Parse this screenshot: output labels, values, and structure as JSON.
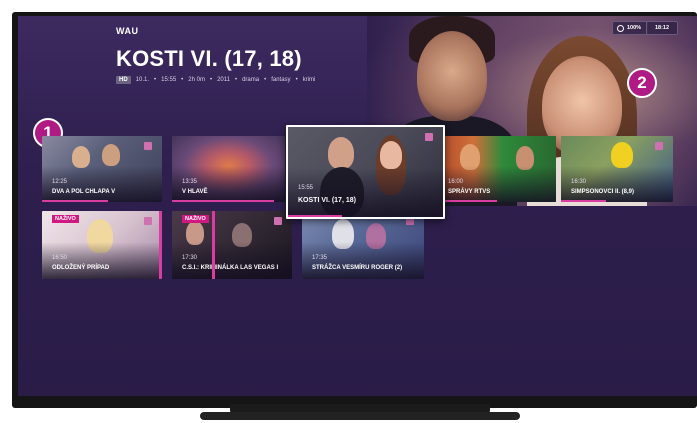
{
  "app": {
    "logo": "WAU",
    "title": "KOSTI VI. (17, 18)"
  },
  "meta": {
    "quality_badge": "HD",
    "items": [
      "10.1.",
      "•",
      "15:55",
      "•",
      "2h 0m",
      "•",
      "2011",
      "•",
      "drama",
      "•",
      "fantasy",
      "•",
      "krimi"
    ]
  },
  "status": {
    "battery": "100%",
    "time": "18:12"
  },
  "callouts": [
    "1",
    "2"
  ],
  "row1": [
    {
      "time": "12:25",
      "name": "DVA A POL CHLAPA V"
    },
    {
      "time": "13:35",
      "name": "V HLAVĚ"
    },
    {
      "time": "15:55",
      "name": "KOSTI VI. (17, 18)"
    },
    {
      "time": "16:00",
      "name": "SPRÁVY RTVS"
    },
    {
      "time": "16:30",
      "name": "SIMPSONOVCI II. (8,9)"
    }
  ],
  "row2": [
    {
      "badge": "NAŽIVO",
      "time": "16:50",
      "name": "ODLOŽENÝ PRÍPAD"
    },
    {
      "badge": "NAŽIVO",
      "time": "17:30",
      "name": "C.S.I.: KRIMINÁLKA LAS VEGAS I"
    },
    {
      "time": "17:35",
      "name": "STRÁŽCA VESMÍRU ROGER (2)"
    }
  ],
  "progress": [
    0.55,
    0.9,
    0.35,
    0.5,
    0.4
  ],
  "colors": {
    "accent": "#d93da0",
    "callout": "#b01a84",
    "background": "#2e1f4e"
  }
}
